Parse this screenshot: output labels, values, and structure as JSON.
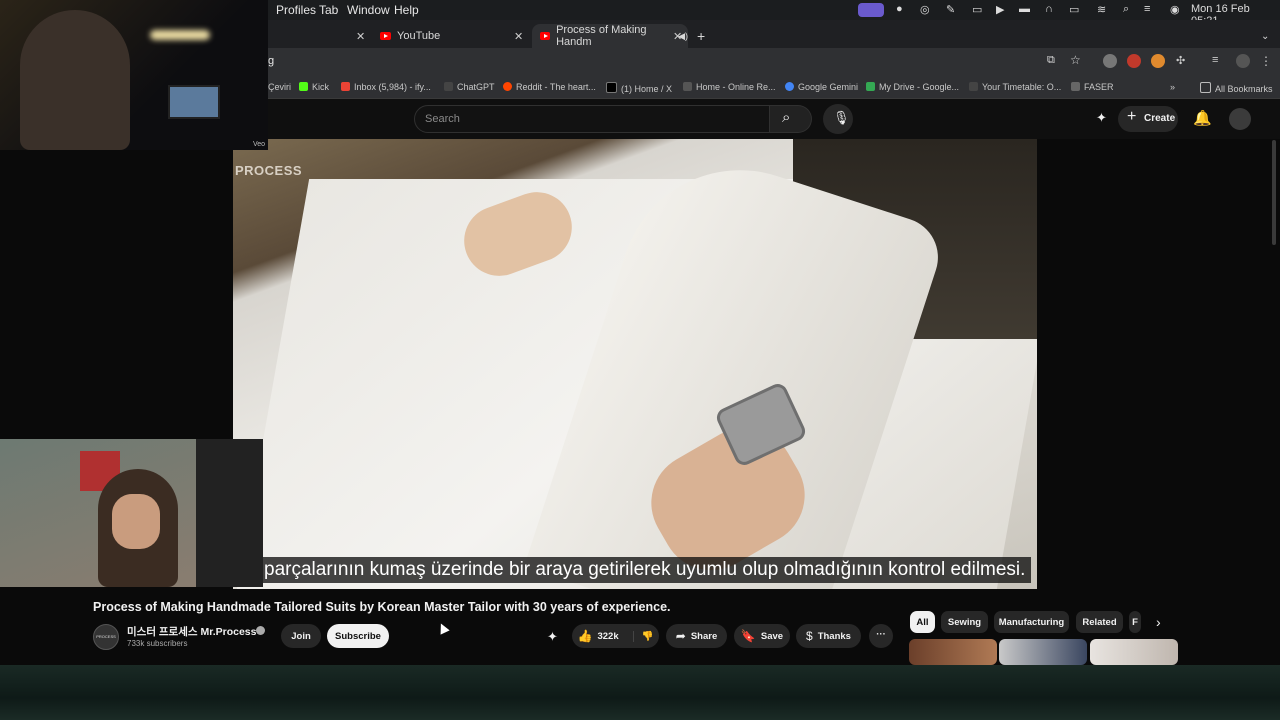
{
  "menubar": {
    "items": [
      "Profiles",
      "Tab",
      "Window",
      "Help"
    ],
    "clock": "Mon 16 Feb  05:21"
  },
  "tabs": [
    {
      "label": "YouTube",
      "active": false
    },
    {
      "label": "Process of Making Handm",
      "active": true
    }
  ],
  "new_tab": "+",
  "address": {
    "url": "g"
  },
  "bookmarks": [
    {
      "label": "Çeviri",
      "color": "#4285f4"
    },
    {
      "label": "Kick",
      "color": "#53fc18"
    },
    {
      "label": "Inbox (5,984) - ify...",
      "color": "#ea4335"
    },
    {
      "label": "ChatGPT",
      "color": "#333333"
    },
    {
      "label": "Reddit - The heart...",
      "color": "#ff4500"
    },
    {
      "label": "(1) Home / X",
      "color": "#000000"
    },
    {
      "label": "Home - Online Re...",
      "color": "#555555"
    },
    {
      "label": "Google Gemini",
      "color": "#4285f4"
    },
    {
      "label": "My Drive - Google...",
      "color": "#34a853"
    },
    {
      "label": "Your Timetable: O...",
      "color": "#444444"
    },
    {
      "label": "FASER",
      "color": "#666666"
    }
  ],
  "all_bookmarks": "All Bookmarks",
  "youtube": {
    "search_placeholder": "Search",
    "create_label": "Create",
    "watermark": "PROCESS",
    "subtitle": "parçalarının kumaş üzerinde bir araya getirilerek uyumlu olup olmadığının kontrol edilmesi.",
    "video_title": "Process of Making Handmade Tailored Suits by Korean Master Tailor with 30 years of experience.",
    "channel_name": "미스터 프로세스 Mr.Process",
    "channel_avatar_text": "PROCESS",
    "subscribers": "733k subscribers",
    "join_label": "Join",
    "subscribe_label": "Subscribe",
    "like_count": "322k",
    "share_label": "Share",
    "save_label": "Save",
    "thanks_label": "Thanks",
    "chips": [
      "All",
      "Sewing",
      "Manufacturing",
      "Related",
      "F"
    ]
  },
  "overlay": {
    "veo_text": "Veo"
  }
}
